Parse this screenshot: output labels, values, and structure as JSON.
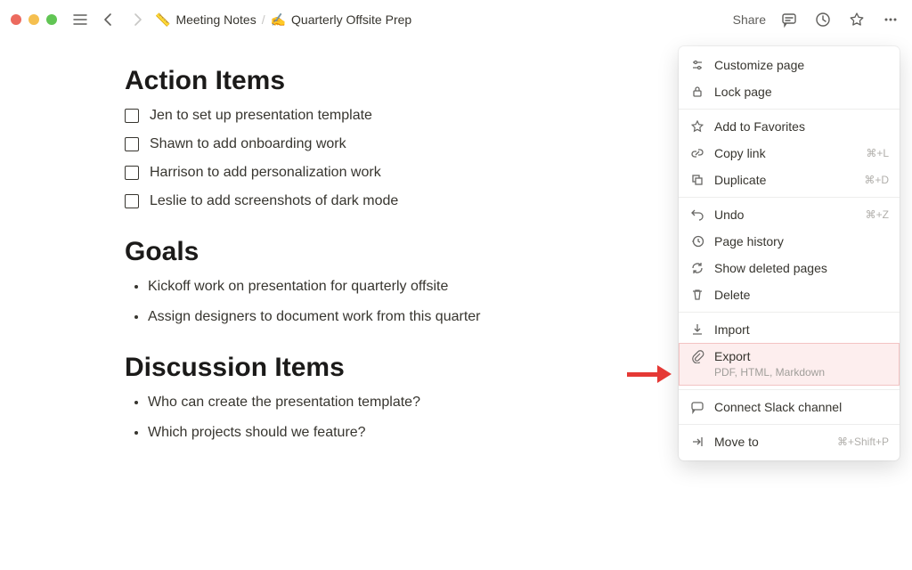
{
  "breadcrumb": {
    "parent_icon": "📏",
    "parent_label": "Meeting Notes",
    "current_icon": "✍️",
    "current_label": "Quarterly Offsite Prep"
  },
  "topbar": {
    "share_label": "Share"
  },
  "sections": {
    "action_items": {
      "title": "Action Items",
      "items": [
        "Jen to set up presentation template",
        "Shawn to add onboarding work",
        "Harrison to add personalization work",
        "Leslie to add screenshots of dark mode"
      ]
    },
    "goals": {
      "title": "Goals",
      "items": [
        "Kickoff work on presentation for quarterly offsite",
        "Assign designers to document work from this quarter"
      ]
    },
    "discussion": {
      "title": "Discussion Items",
      "items": [
        "Who can create the presentation template?",
        "Which projects should we feature?"
      ]
    }
  },
  "menu": {
    "customize": "Customize page",
    "lock": "Lock page",
    "favorites": "Add to Favorites",
    "copy_link": {
      "label": "Copy link",
      "shortcut": "⌘+L"
    },
    "duplicate": {
      "label": "Duplicate",
      "shortcut": "⌘+D"
    },
    "undo": {
      "label": "Undo",
      "shortcut": "⌘+Z"
    },
    "page_history": "Page history",
    "show_deleted": "Show deleted pages",
    "delete": "Delete",
    "import": "Import",
    "export": {
      "label": "Export",
      "sub": "PDF, HTML, Markdown"
    },
    "connect_slack": "Connect Slack channel",
    "move_to": {
      "label": "Move to",
      "shortcut": "⌘+Shift+P"
    }
  }
}
